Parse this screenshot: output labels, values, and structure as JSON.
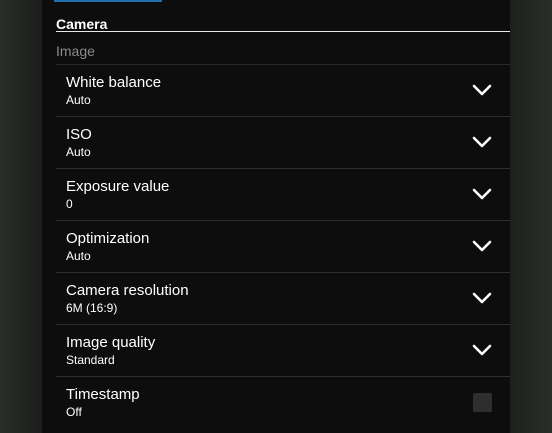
{
  "header": {
    "tab_title": "Camera"
  },
  "section": {
    "title": "Image"
  },
  "settings": [
    {
      "label": "White balance",
      "value": "Auto",
      "control": "chevron-down-icon"
    },
    {
      "label": "ISO",
      "value": "Auto",
      "control": "chevron-down-icon"
    },
    {
      "label": "Exposure value",
      "value": "0",
      "control": "chevron-down-icon"
    },
    {
      "label": "Optimization",
      "value": "Auto",
      "control": "chevron-down-icon"
    },
    {
      "label": "Camera resolution",
      "value": "6M (16:9)",
      "control": "chevron-down-icon"
    },
    {
      "label": "Image quality",
      "value": "Standard",
      "control": "chevron-down-icon"
    },
    {
      "label": "Timestamp",
      "value": "Off",
      "control": "checkbox",
      "checked": false
    }
  ],
  "colors": {
    "panel_background": "#0d0d0d",
    "accent": "#1f6fb0",
    "text_primary": "#ffffff",
    "text_section": "#8a8a8a",
    "divider": "#2e2e2e"
  }
}
